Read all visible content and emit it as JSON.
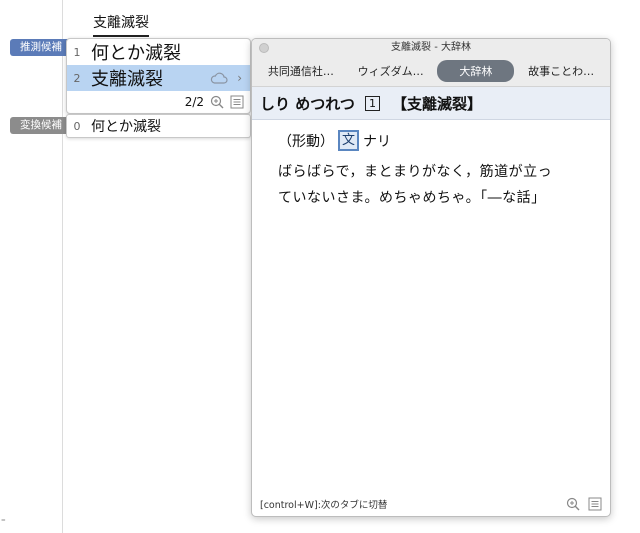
{
  "input": {
    "composing_text": "支離滅裂"
  },
  "labels": {
    "prediction": "推測候補",
    "conversion": "変換候補"
  },
  "prediction_candidates": [
    {
      "index": "1",
      "text": "何とか滅裂"
    },
    {
      "index": "2",
      "text": "支離滅裂"
    }
  ],
  "prediction_pager": "2/2",
  "conversion_candidates": [
    {
      "index": "0",
      "text": "何とか滅裂"
    }
  ],
  "dictionary": {
    "window_title": "支離滅裂 - 大辞林",
    "tabs": [
      {
        "label": "共同通信社…"
      },
      {
        "label": "ウィズダム…"
      },
      {
        "label": "大辞林"
      },
      {
        "label": "故事ことわ…"
      }
    ],
    "active_tab": "大辞林",
    "headword_reading": "しり めつれつ",
    "sense_number": "1",
    "headword_kanji": "【支離滅裂】",
    "pos_prefix": "（形動）",
    "pos_box": "文",
    "pos_suffix": "ナリ",
    "definition_line1": "ばらばらで，まとまりがなく，筋道が立っ",
    "definition_line2": "ていないさま。めちゃめちゃ。「―な話」",
    "footer_hint": "[control+W]:次のタブに切替"
  },
  "corner_mark": "⁼"
}
